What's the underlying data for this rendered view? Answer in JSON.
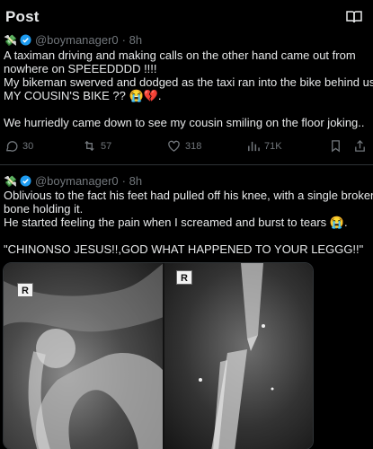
{
  "header": {
    "title": "Post",
    "reader_icon": "reader-mode-icon"
  },
  "tweets": [
    {
      "emoji": "💸",
      "handle": "@boymanager0",
      "time": "· 8h",
      "lines": [
        "A taximan driving and making calls on the other hand came out from",
        "nowhere on SPEEEDDDD !!!!",
        "My bikeman swerved and dodged as the taxi ran into the bike behind us ..",
        "MY COUSIN'S BIKE ?? 😭💔.",
        "",
        "We hurriedly came down to see my cousin smiling on the floor joking.."
      ],
      "replies": "30",
      "reposts": "57",
      "likes": "318",
      "views": "71K"
    },
    {
      "emoji": "💸",
      "handle": "@boymanager0",
      "time": "· 8h",
      "lines": [
        "Oblivious to the fact his feet had pulled off his knee, with a single broken",
        "bone holding it.",
        "He started feeling the pain when I screamed and burst to tears 😭.",
        "",
        "\"CHINONSO JESUS!!,GOD WHAT HAPPENED TO YOUR LEGGG!!\""
      ],
      "media": {
        "left_marker": "R",
        "right_marker": "R"
      }
    }
  ],
  "colors": {
    "background": "#000000",
    "text": "#e7e9ea",
    "muted": "#71767b",
    "verified": "#1d9bf0",
    "divider": "#2f3336"
  }
}
